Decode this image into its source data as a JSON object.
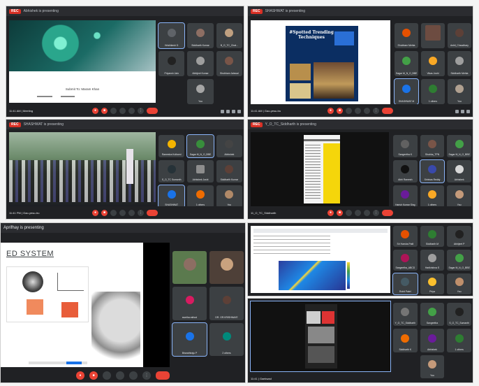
{
  "colors": {
    "accent": "#8ab4f8",
    "danger": "#ea4335",
    "tile": "#3c4043",
    "bg": "#202124"
  },
  "screens": [
    {
      "presenter": "Abhishek is presenting",
      "meeting": "11:41 AM | Meeting",
      "slide_caption": "Submit To: Maram Khan",
      "tiles": [
        "Hrishikesh D",
        "Siddharth Kumar",
        "B_O_TC_Chat...",
        "Priyansh Jain",
        "Abhijeet Kumar",
        "Shubham Jaiswal",
        "You"
      ]
    },
    {
      "presenter": "SHASHWAT is presenting",
      "meeting": "11:41 AM | Gao-yesu-tru",
      "slide_title": "#Spotted Trending Techniques",
      "tiles": [
        "Shubham Mehta",
        "",
        "Ankit_Chaudhary",
        "Sagar M_N_O_BBE",
        "Vikas Joshi",
        "Siddharth Mehta",
        "SHASHWAT M",
        "1 others",
        "You"
      ]
    },
    {
      "presenter": "SHASHWAT is presenting",
      "meeting": "11:41 PM | Gao-yesu-tru",
      "tiles": [
        "Ramesha Kulkarni",
        "Sagar M_N_O_BBE",
        "Abhishek",
        "S_O_TC Sumanth",
        "Abhishek Joshi",
        "Siddharth Kumar",
        "SHASHWAT",
        "1 others",
        "You"
      ]
    },
    {
      "presenter": "Y_O_TC_Siddharth is presenting",
      "meeting": "11_O_TC_Siddharth",
      "tiles": [
        "Sangeetha K",
        "Shubha_TPN",
        "Sagar M_N_O_BBE",
        "Abhi Ramesh",
        "Srinivas Reddy",
        "Abhishek",
        "Harish Kumar Sing",
        "1 others",
        "You"
      ]
    },
    {
      "presenter": "Aprifhay is presenting",
      "slide_text": "ED SYSTEM",
      "tiles": [
        "",
        "",
        "swetha rathod",
        "DR. GR.KRISHNAVE",
        "Bharathiraju P",
        "2 others"
      ]
    },
    {
      "presenter": "SHASHWAT is presenting",
      "tiles": [
        "Sri Harsha Patil",
        "Siddharth M",
        "Abhijeet P",
        "Sangeetha_ABCD",
        "Harikrishna S",
        "Sagar M_N_O_BBE",
        "Rohit Patel",
        "Priya",
        "You"
      ]
    },
    {
      "meeting": "11:41 | Gaekwad",
      "tiles": [
        "Y_O_TC_Siddharth",
        "Sangeetha",
        "S_O_TC_Sumanth",
        "Siddharth K",
        "Abhishek",
        "1 others",
        "You"
      ]
    }
  ]
}
